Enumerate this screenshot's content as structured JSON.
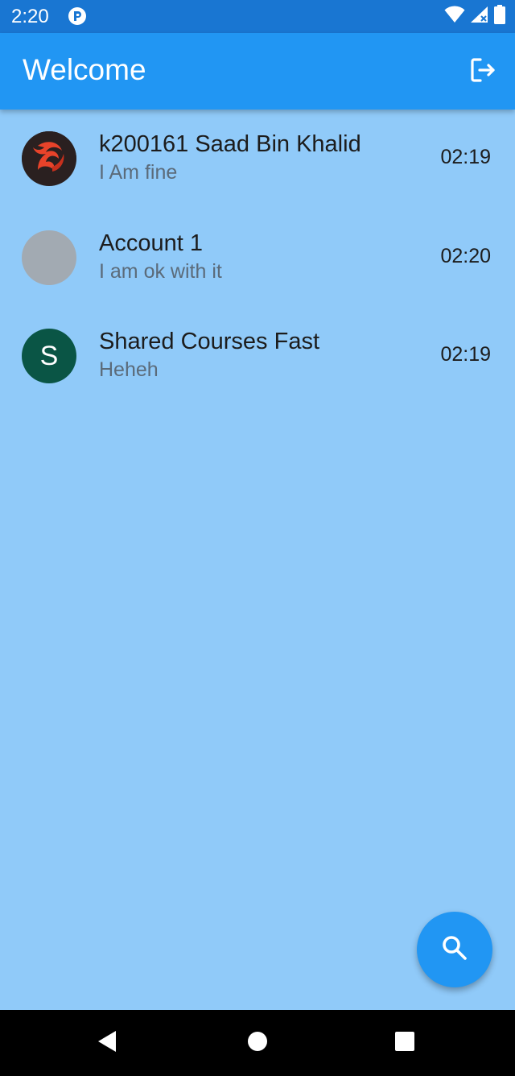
{
  "status_bar": {
    "time": "2:20",
    "icons": [
      "app-notification-icon",
      "wifi-icon",
      "signal-icon",
      "battery-icon"
    ]
  },
  "app_bar": {
    "title": "Welcome",
    "action_icon": "logout-icon"
  },
  "chats": [
    {
      "name": "k200161 Saad Bin Khalid",
      "preview": "I Am fine",
      "time": "02:19",
      "avatar": {
        "type": "image",
        "icon": "phoenix-logo-icon",
        "bg": "#2a2020",
        "accent": "#e8432a"
      }
    },
    {
      "name": "Account 1",
      "preview": "I am ok with it",
      "time": "02:20",
      "avatar": {
        "type": "blank",
        "bg": "#a2aab2"
      }
    },
    {
      "name": "Shared Courses Fast",
      "preview": "Heheh",
      "time": "02:19",
      "avatar": {
        "type": "letter",
        "letter": "S",
        "bg": "#0a5545"
      }
    }
  ],
  "fab": {
    "icon": "search-icon"
  },
  "nav_bar": {
    "buttons": [
      "back-icon",
      "home-icon",
      "recents-icon"
    ]
  },
  "colors": {
    "status_bar": "#1976D2",
    "app_bar": "#2196F3",
    "background": "#90CAF9",
    "fab": "#2196F3"
  }
}
